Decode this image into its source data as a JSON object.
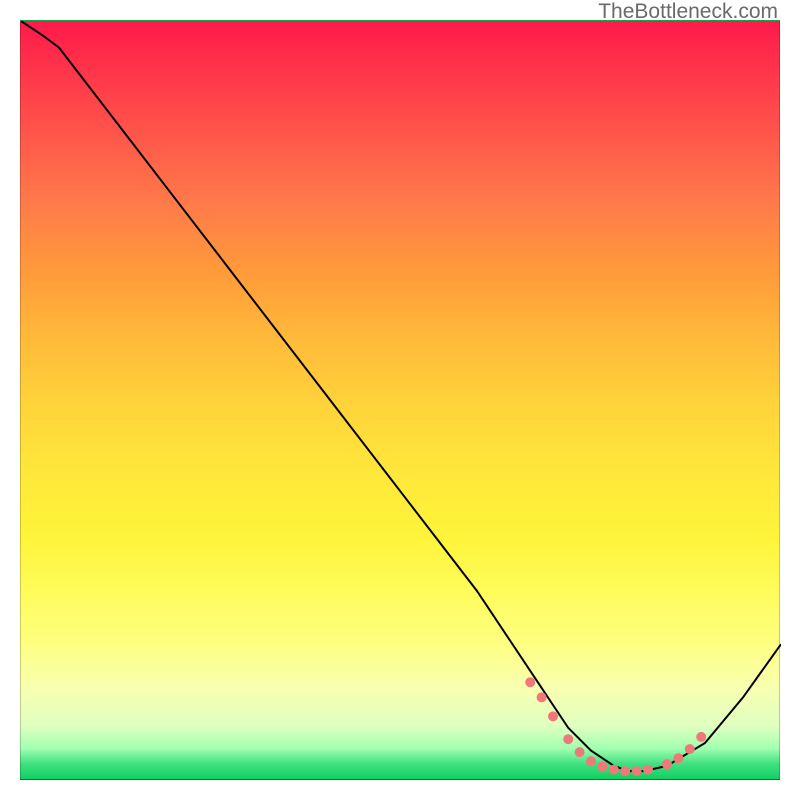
{
  "watermark": "TheBottleneck.com",
  "chart_data": {
    "type": "line",
    "title": "",
    "xlabel": "",
    "ylabel": "",
    "xlim": [
      0,
      100
    ],
    "ylim": [
      0,
      100
    ],
    "series": [
      {
        "name": "curve",
        "x": [
          0,
          3,
          5,
          10,
          20,
          30,
          40,
          50,
          60,
          68,
          70,
          72,
          75,
          78,
          80,
          82,
          85,
          90,
          95,
          100
        ],
        "y": [
          100,
          98,
          96.5,
          90,
          77,
          64,
          51,
          38,
          25,
          13,
          10,
          7,
          4,
          2,
          1.3,
          1.3,
          2,
          5,
          11,
          18
        ]
      }
    ],
    "markers": {
      "name": "dots",
      "points": [
        {
          "x": 67,
          "y": 13
        },
        {
          "x": 68.5,
          "y": 11
        },
        {
          "x": 70,
          "y": 8.5
        },
        {
          "x": 72,
          "y": 5.5
        },
        {
          "x": 73.5,
          "y": 3.8
        },
        {
          "x": 75,
          "y": 2.6
        },
        {
          "x": 76.5,
          "y": 1.9
        },
        {
          "x": 78,
          "y": 1.5
        },
        {
          "x": 79.5,
          "y": 1.3
        },
        {
          "x": 81,
          "y": 1.3
        },
        {
          "x": 82.5,
          "y": 1.5
        },
        {
          "x": 85,
          "y": 2.2
        },
        {
          "x": 86.5,
          "y": 3.0
        },
        {
          "x": 88,
          "y": 4.2
        },
        {
          "x": 89.5,
          "y": 5.8
        }
      ]
    },
    "colors": {
      "curve": "#000000",
      "markers": "#f07878",
      "gradient_top": "#ff1a4a",
      "gradient_bottom": "#10d060"
    }
  }
}
